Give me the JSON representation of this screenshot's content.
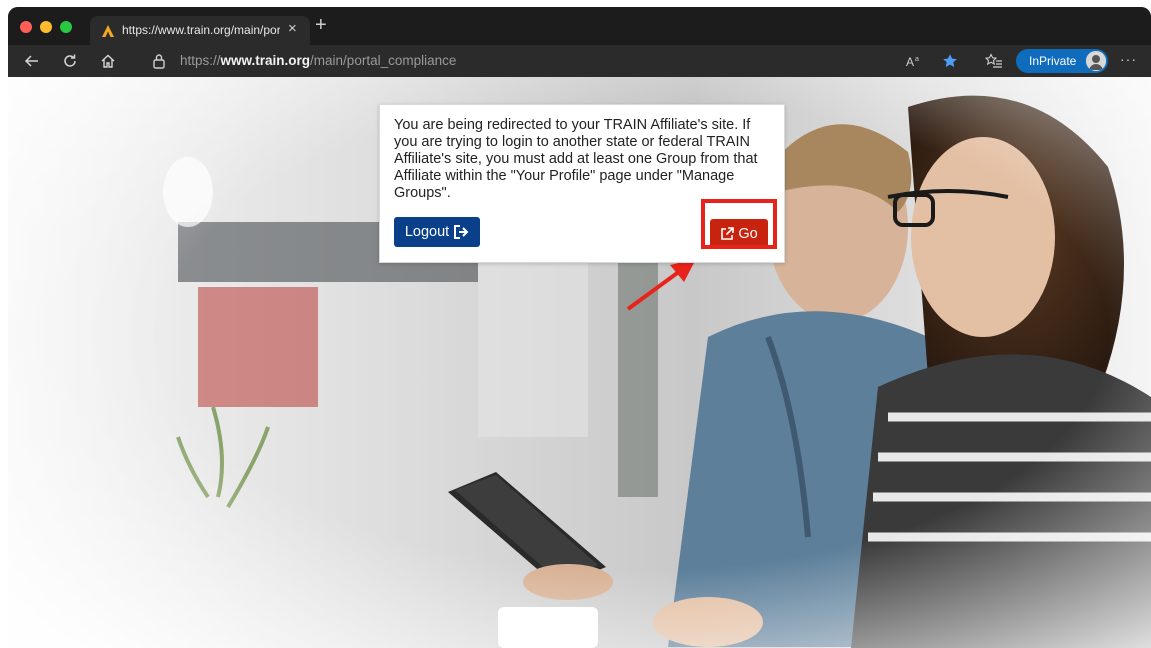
{
  "browser": {
    "tab": {
      "title": "https://www.train.org/main/portal_compliance",
      "favicon": "train-logo-icon",
      "close_label": "×"
    },
    "new_tab_label": "+",
    "url": {
      "scheme": "https://",
      "host": "www.train.org",
      "path": "/main/portal_compliance"
    },
    "inprivate_label": "InPrivate",
    "more_label": "···",
    "accent": "#0f6cbd"
  },
  "dialog": {
    "message": "You are being redirected to your TRAIN Affiliate's site. If you are trying to login to another state or federal TRAIN Affiliate's site, you must add at least one Group from that Affiliate within the \"Your Profile\" page under \"Manage Groups\".",
    "logout_label": "Logout",
    "go_label": "Go",
    "logout_color": "#0a3f8a",
    "go_color": "#c8230f"
  },
  "annotation": {
    "highlight_color": "#e8231b"
  }
}
